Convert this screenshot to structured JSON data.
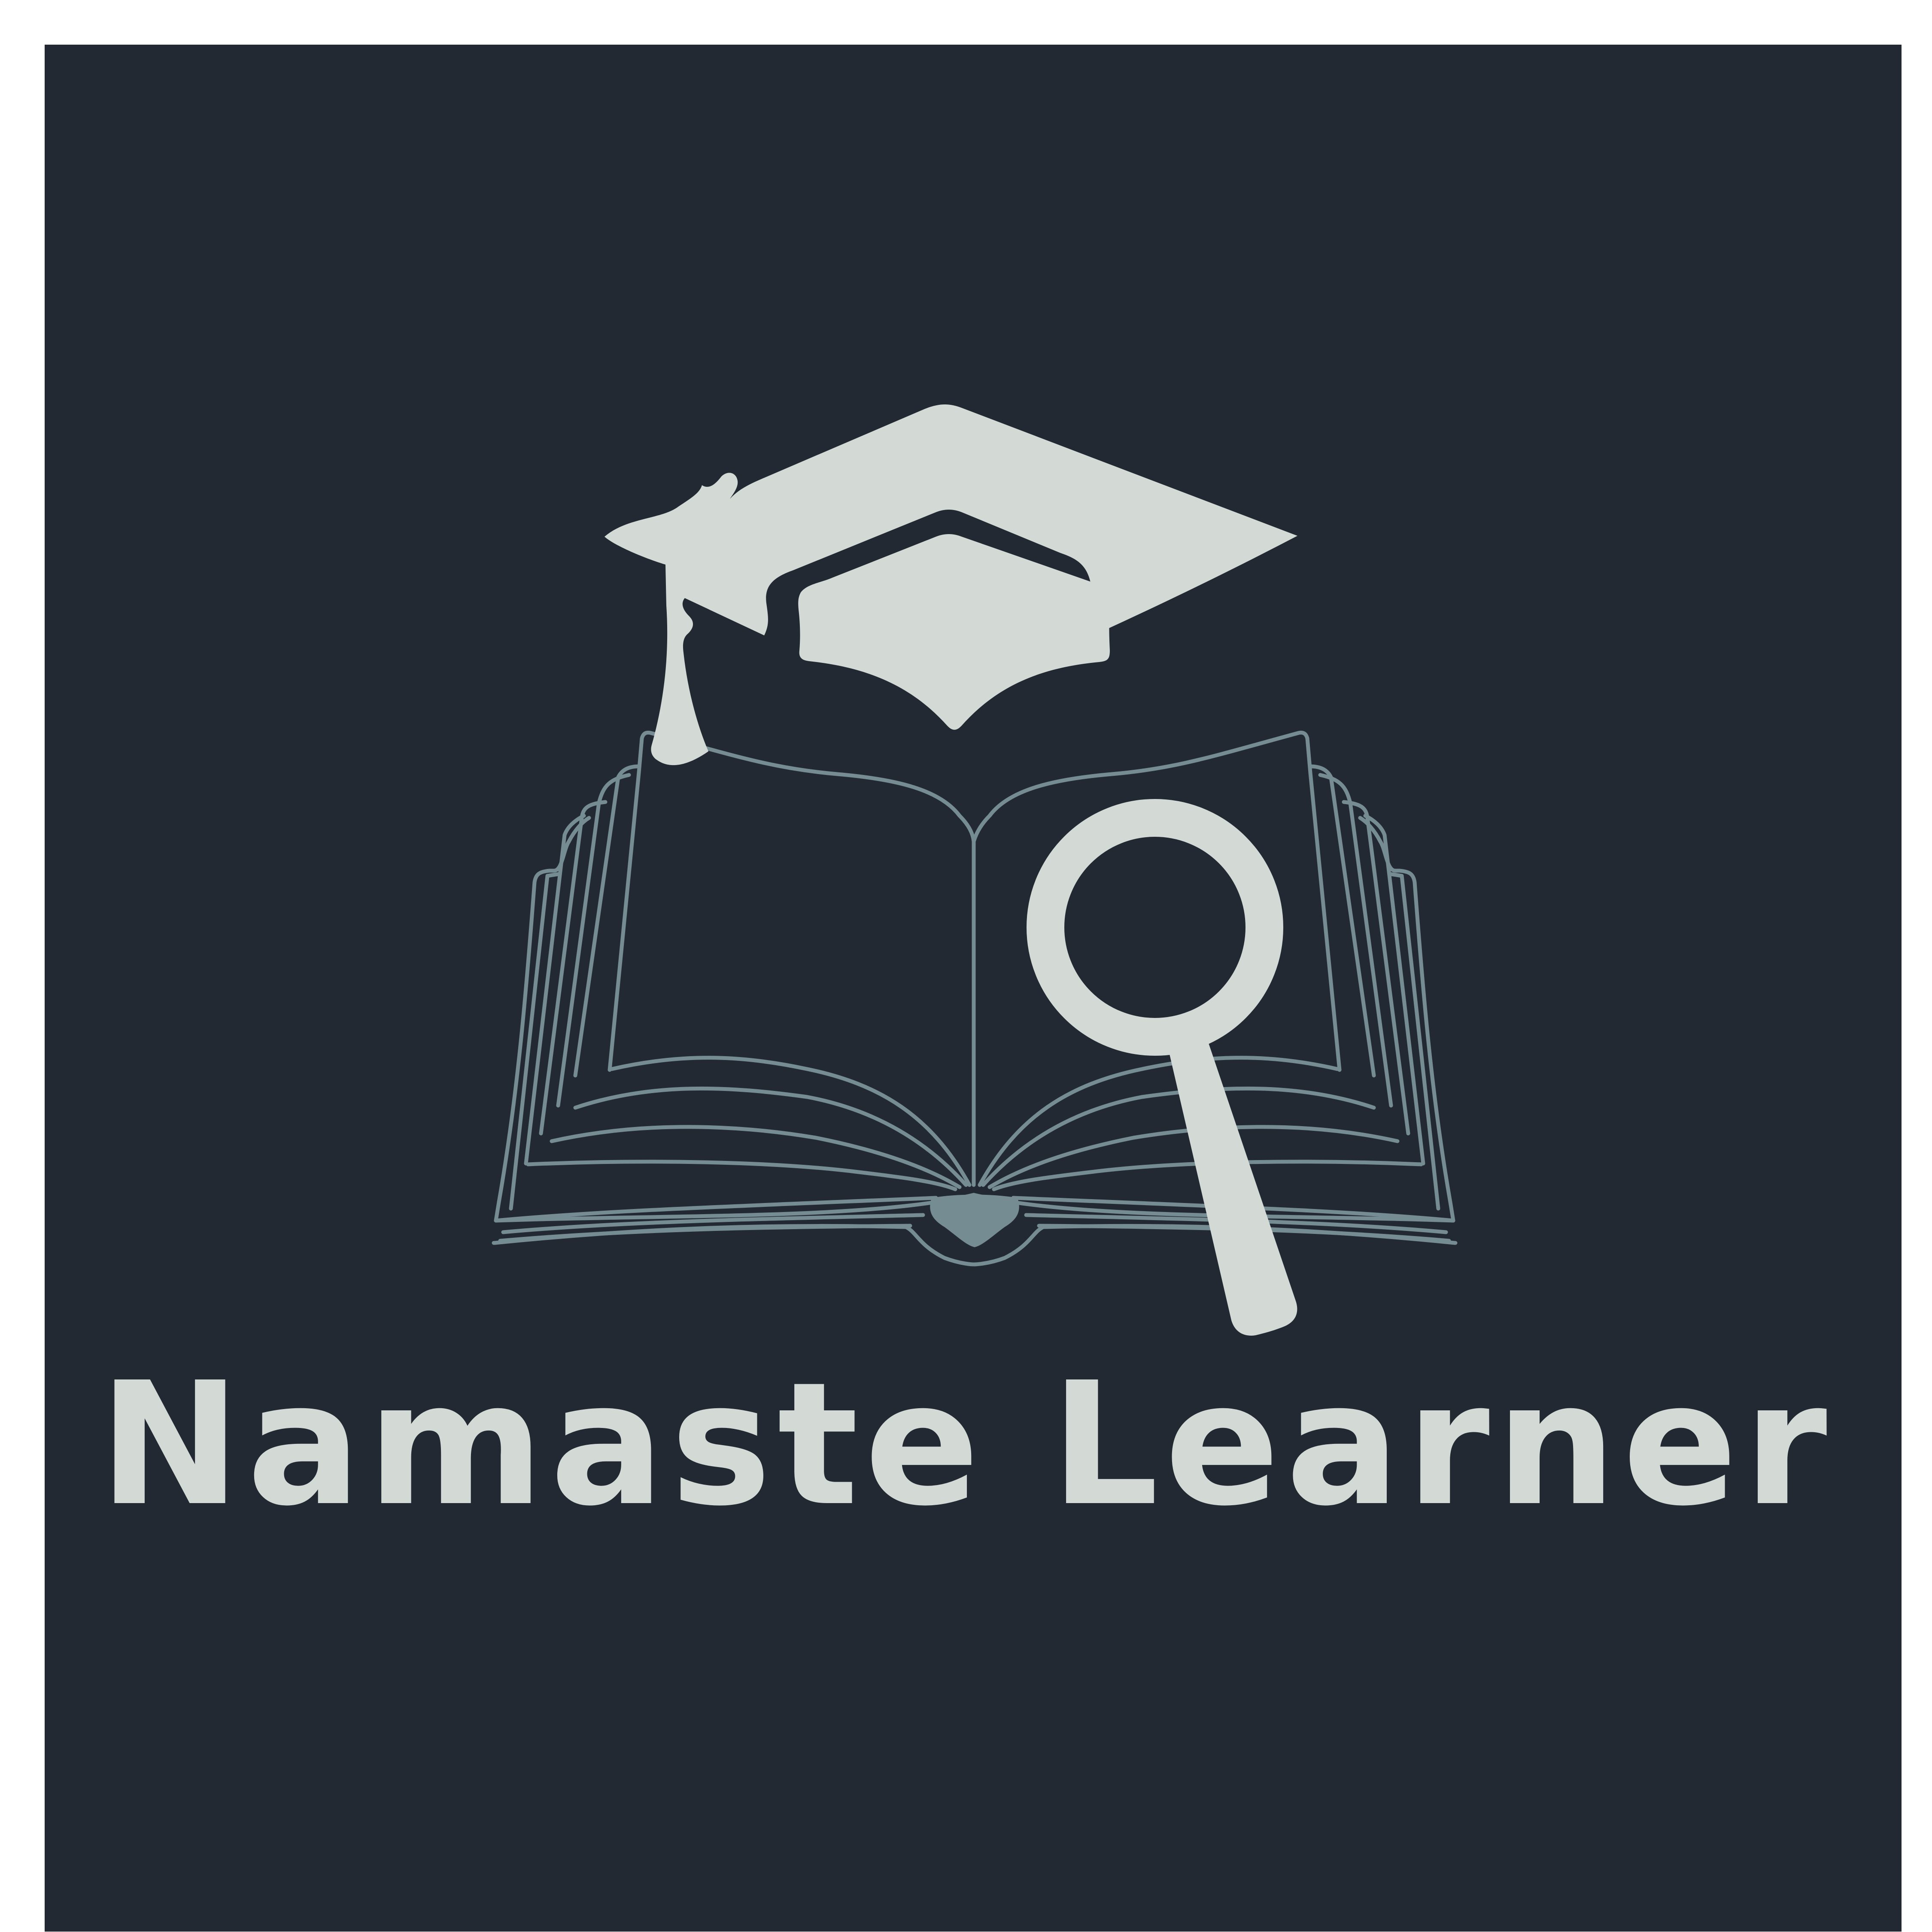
{
  "brand": {
    "name": "Namaste Learner"
  },
  "icons": {
    "cap": "graduation-cap-icon",
    "book": "open-book-icon",
    "magnifier": "magnifying-glass-icon"
  },
  "colors": {
    "background": "#222932",
    "border": "#ffffff",
    "primary": "#d3dad6",
    "accent": "#758c93"
  }
}
